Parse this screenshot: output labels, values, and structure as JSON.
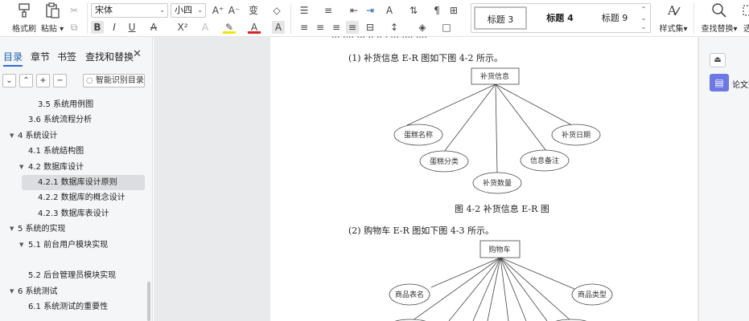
{
  "ribbon": {
    "format_painter": "格式刷",
    "paste": "粘贴",
    "font_name": "宋体",
    "font_size": "小四",
    "style_gallery": [
      "标题 3",
      "标题 4",
      "标题 9"
    ],
    "styles_label": "样式集",
    "find_replace_label": "查找替换",
    "overflow_label": "选"
  },
  "nav": {
    "tabs": [
      "目录",
      "章节",
      "书签",
      "查找和替换"
    ],
    "smart_toc_label": "智能识别目录",
    "items": [
      {
        "label": "3.5 系统用例图",
        "level": 3,
        "expanded": false,
        "has_children": false,
        "selected": false
      },
      {
        "label": "3.6 系统流程分析",
        "level": 2,
        "expanded": false,
        "has_children": false,
        "selected": false
      },
      {
        "label": "4 系统设计",
        "level": 1,
        "expanded": true,
        "has_children": true,
        "selected": false
      },
      {
        "label": "4.1 系统结构图",
        "level": 2,
        "expanded": false,
        "has_children": false,
        "selected": false
      },
      {
        "label": "4.2 数据库设计",
        "level": 2,
        "expanded": true,
        "has_children": true,
        "selected": false
      },
      {
        "label": "4.2.1 数据库设计原则",
        "level": 3,
        "expanded": false,
        "has_children": false,
        "selected": true
      },
      {
        "label": "4.2.2 数据库的概念设计",
        "level": 3,
        "expanded": false,
        "has_children": false,
        "selected": false
      },
      {
        "label": "4.2.3 数据库表设计",
        "level": 3,
        "expanded": false,
        "has_children": false,
        "selected": false
      },
      {
        "label": "5 系统的实现",
        "level": 1,
        "expanded": true,
        "has_children": true,
        "selected": false
      },
      {
        "label": "5.1  前台用户模块实现",
        "level": 2,
        "expanded": true,
        "has_children": true,
        "selected": false
      },
      {
        "label": "",
        "level": 2,
        "expanded": false,
        "has_children": false,
        "selected": false
      },
      {
        "label": "5.2 后台管理员模块实现",
        "level": 2,
        "expanded": false,
        "has_children": false,
        "selected": false
      },
      {
        "label": "6 系统测试",
        "level": 1,
        "expanded": true,
        "has_children": true,
        "selected": false
      },
      {
        "label": "6.1 系统测试的重要性",
        "level": 2,
        "expanded": false,
        "has_children": false,
        "selected": false
      }
    ]
  },
  "doc": {
    "item1": "(1)  补货信息 E-R 图如下图 4-2 所示。",
    "fig1_caption": "图 4-2 补货信息 E-R 图",
    "item2": "(2)  购物车 E-R 图如下图 4-3 所示。",
    "fig1": {
      "entity": "补货信息",
      "attributes": [
        "蛋糕名称",
        "蛋糕分类",
        "补货数量",
        "信息备注",
        "补货日期"
      ]
    },
    "fig2": {
      "entity": "购物车",
      "attributes": [
        "商品表名",
        "商品类型"
      ]
    }
  },
  "right_pane": {
    "paper_label": "论文查"
  }
}
